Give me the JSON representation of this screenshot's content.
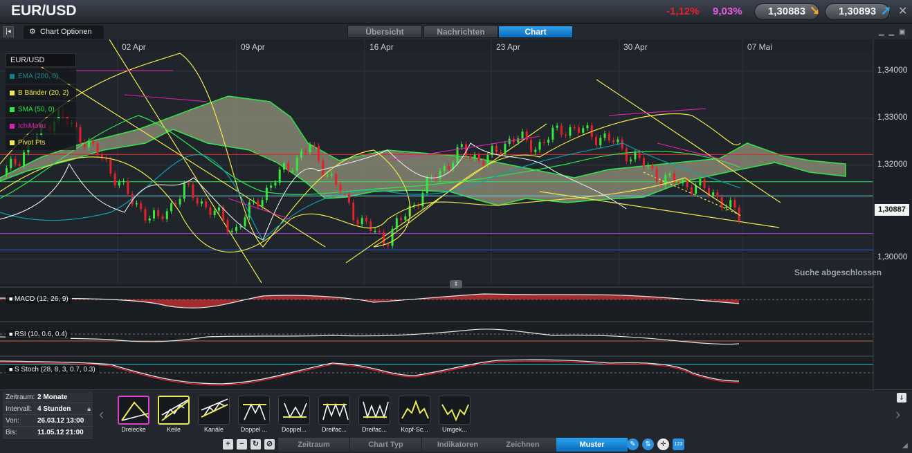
{
  "header": {
    "title": "EUR/USD",
    "change_abs": "-1,12%",
    "change_pct": "9,03%",
    "sell_price": "1,30883",
    "buy_price": "1,30893",
    "sell_arrow": "arrow-down-icon",
    "buy_arrow": "arrow-up-icon"
  },
  "toolbar": {
    "chart_options": "Chart Optionen",
    "tabs": [
      "Übersicht",
      "Nachrichten",
      "Chart"
    ],
    "active_tab": "Chart"
  },
  "chart": {
    "dates": [
      "02 Apr",
      "09 Apr",
      "16 Apr",
      "23 Apr",
      "30 Apr",
      "07 Mai"
    ],
    "prices": [
      "1,34000",
      "1,33000",
      "1,32000",
      "1,30000"
    ],
    "current_price": "1,30887",
    "search_status": "Suche abgeschlossen",
    "legend_title": "EUR/USD",
    "legend": [
      {
        "label": "EMA (200, 0)",
        "color": "#0e7f8a"
      },
      {
        "label": "B Bänder (20, 2)",
        "color": "#f2e84b"
      },
      {
        "label": "SMA (50, 0)",
        "color": "#2ee84b"
      },
      {
        "label": "IchiMoku",
        "color": "#e021b0"
      },
      {
        "label": "Pivot Pts",
        "color": "#f2e84b"
      }
    ],
    "indicators": [
      "MACD (12, 26, 9)",
      "RSI (10, 0.6, 0.4)",
      "S Stoch (28, 8, 3, 0.7, 0.3)"
    ]
  },
  "chart_data": {
    "type": "candlestick",
    "title": "EUR/USD",
    "x_labels": [
      "02 Apr",
      "09 Apr",
      "16 Apr",
      "23 Apr",
      "30 Apr",
      "07 Mai"
    ],
    "y_ticks": [
      1.34,
      1.33,
      1.32,
      1.3
    ],
    "ylim": [
      1.295,
      1.345
    ],
    "last_price": 1.30887,
    "series": [
      {
        "name": "EMA (200, 0)",
        "color": "#0e7f8a"
      },
      {
        "name": "B Bänder (20, 2)",
        "color": "#f2e84b"
      },
      {
        "name": "SMA (50, 0)",
        "color": "#2ee84b"
      },
      {
        "name": "IchiMoku",
        "color": "#e021b0"
      },
      {
        "name": "Pivot Pts",
        "color": "#f2e84b"
      }
    ],
    "pivot_levels": [
      1.3223,
      1.3165,
      1.3135,
      1.3055,
      1.302
    ],
    "close_path": [
      1.3185,
      1.325,
      1.331,
      1.326,
      1.32,
      1.312,
      1.308,
      1.315,
      1.311,
      1.306,
      1.313,
      1.319,
      1.324,
      1.316,
      1.308,
      1.304,
      1.311,
      1.318,
      1.323,
      1.321,
      1.326,
      1.324,
      1.328,
      1.327,
      1.325,
      1.321,
      1.317,
      1.316,
      1.314,
      1.309
    ]
  },
  "bottom": {
    "info": [
      {
        "key": "Zeitraum:",
        "value": "2 Monate"
      },
      {
        "key": "Intervall:",
        "value": "4 Stunden"
      },
      {
        "key": "Von:",
        "value": "26.03.12 13:00"
      },
      {
        "key": "Bis:",
        "value": "11.05.12 21:00"
      }
    ],
    "patterns": [
      "Dreiecke",
      "Keile",
      "Kanäle",
      "Doppel ...",
      "Doppel...",
      "Dreifac...",
      "Dreifac...",
      "Kopf-Sc...",
      "Umgek..."
    ],
    "tabs": [
      "Zeitraum",
      "Chart Typ",
      "Indikatoren",
      "Zeichnen",
      "Muster"
    ],
    "active_tab": "Muster"
  }
}
